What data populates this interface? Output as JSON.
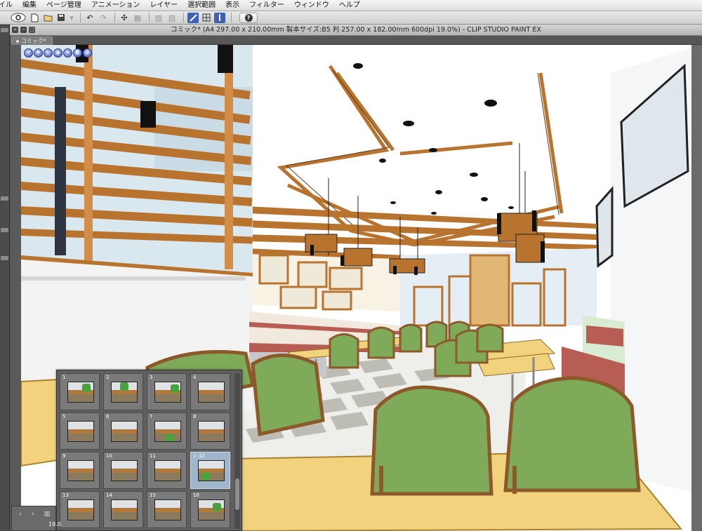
{
  "menu": {
    "items": [
      "イル",
      "編集",
      "ページ管理",
      "アニメーション",
      "レイヤー",
      "選択範囲",
      "表示",
      "フィルター",
      "ウィンドウ",
      "ヘルプ"
    ]
  },
  "toolbar": {
    "icons": [
      "clip-studio-icon",
      "new-file-icon",
      "open-file-icon",
      "save-icon",
      "undo-icon",
      "redo-icon",
      "transform-icon",
      "select-all-icon",
      "clear-icon",
      "snap-ruler-icon",
      "snap-grid-icon",
      "snap-perspective-icon",
      "help-icon"
    ],
    "help_label": "?"
  },
  "document": {
    "title": "コミック* (A4 297.00 x 210.00mm 製本サイズ:B5 判 257.00 x 182.00mm 600dpi 19.0%)  - CLIP STUDIO PAINT EX",
    "tab_label": "コミック*"
  },
  "navigator": {
    "pages": [
      {
        "number": "1",
        "selected": false
      },
      {
        "number": "2",
        "selected": false
      },
      {
        "number": "3",
        "selected": false
      },
      {
        "number": "4",
        "selected": false
      },
      {
        "number": "5",
        "selected": false
      },
      {
        "number": "6",
        "selected": false
      },
      {
        "number": "7",
        "selected": false
      },
      {
        "number": "8",
        "selected": false
      },
      {
        "number": "9",
        "selected": false
      },
      {
        "number": "10",
        "selected": false
      },
      {
        "number": "11",
        "selected": false
      },
      {
        "number": "✓ 12",
        "selected": true
      },
      {
        "number": "13",
        "selected": false
      },
      {
        "number": "14",
        "selected": false
      },
      {
        "number": "15",
        "selected": false
      },
      {
        "number": "16",
        "selected": false
      }
    ],
    "zoom": "19.0"
  },
  "colors": {
    "wood": "#b8732f",
    "chair_green": "#7eaa5a",
    "table_top": "#f3d27d",
    "booth_red": "#b85d54",
    "floor_light": "#eeeeea",
    "floor_dark": "#bdbdb6"
  }
}
